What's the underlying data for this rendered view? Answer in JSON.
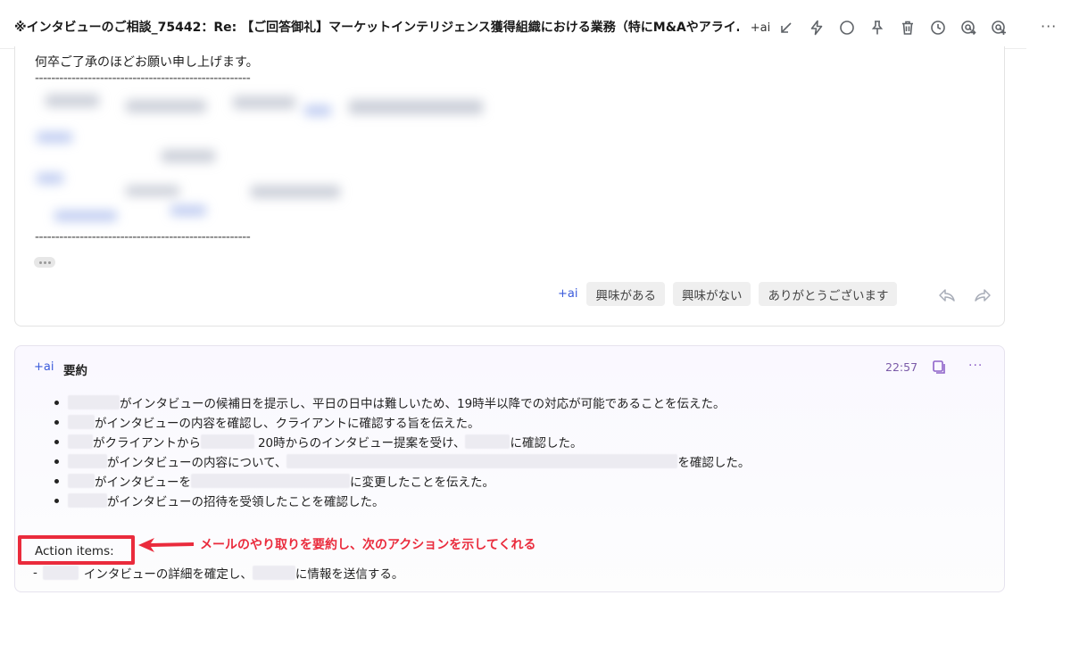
{
  "header": {
    "subject": "※インタビューのご相談_75442：Re: 【ご回答御礼】マーケットインテリジェンス獲得組織における業務（特にM&Aやアライ…",
    "ai_label": "+ai",
    "more_label": "···"
  },
  "email": {
    "closing_line": "何卒ご了承のほどお願い申し上げます。",
    "divider": "-----------------------------------------------------",
    "quick_replies": {
      "ai_label": "+ai",
      "chips": [
        "興味がある",
        "興味がない",
        "ありがとうございます"
      ]
    }
  },
  "summary": {
    "ai_label": "+ai",
    "title": "要約",
    "time": "22:57",
    "more_label": "···",
    "bullets": [
      {
        "text": "がインタビューの候補日を提示し、平日の日中は難しいため、19時半以降での対応が可能であることを伝えた。"
      },
      {
        "text": "がインタビューの内容を確認し、クライアントに確認する旨を伝えた。"
      },
      {
        "part1": "がクライアントから",
        "part2": "20時からのインタビュー提案を受け、",
        "part3": "に確認した。"
      },
      {
        "part1": "がインタビューの内容について、",
        "part2": "を確認した。"
      },
      {
        "part1": "がインタビューを",
        "part2": "に変更したことを伝えた。"
      },
      {
        "text": "がインタビューの招待を受領したことを確認した。"
      }
    ],
    "action_label": "Action items:",
    "action_item": {
      "prefix": "-",
      "part1": "インタビューの詳細を確定し、",
      "part2": "に情報を送信する。"
    }
  },
  "annotation": {
    "text": "メールのやり取りを要約し、次のアクションを示してくれる",
    "color": "#ea2b3c"
  }
}
